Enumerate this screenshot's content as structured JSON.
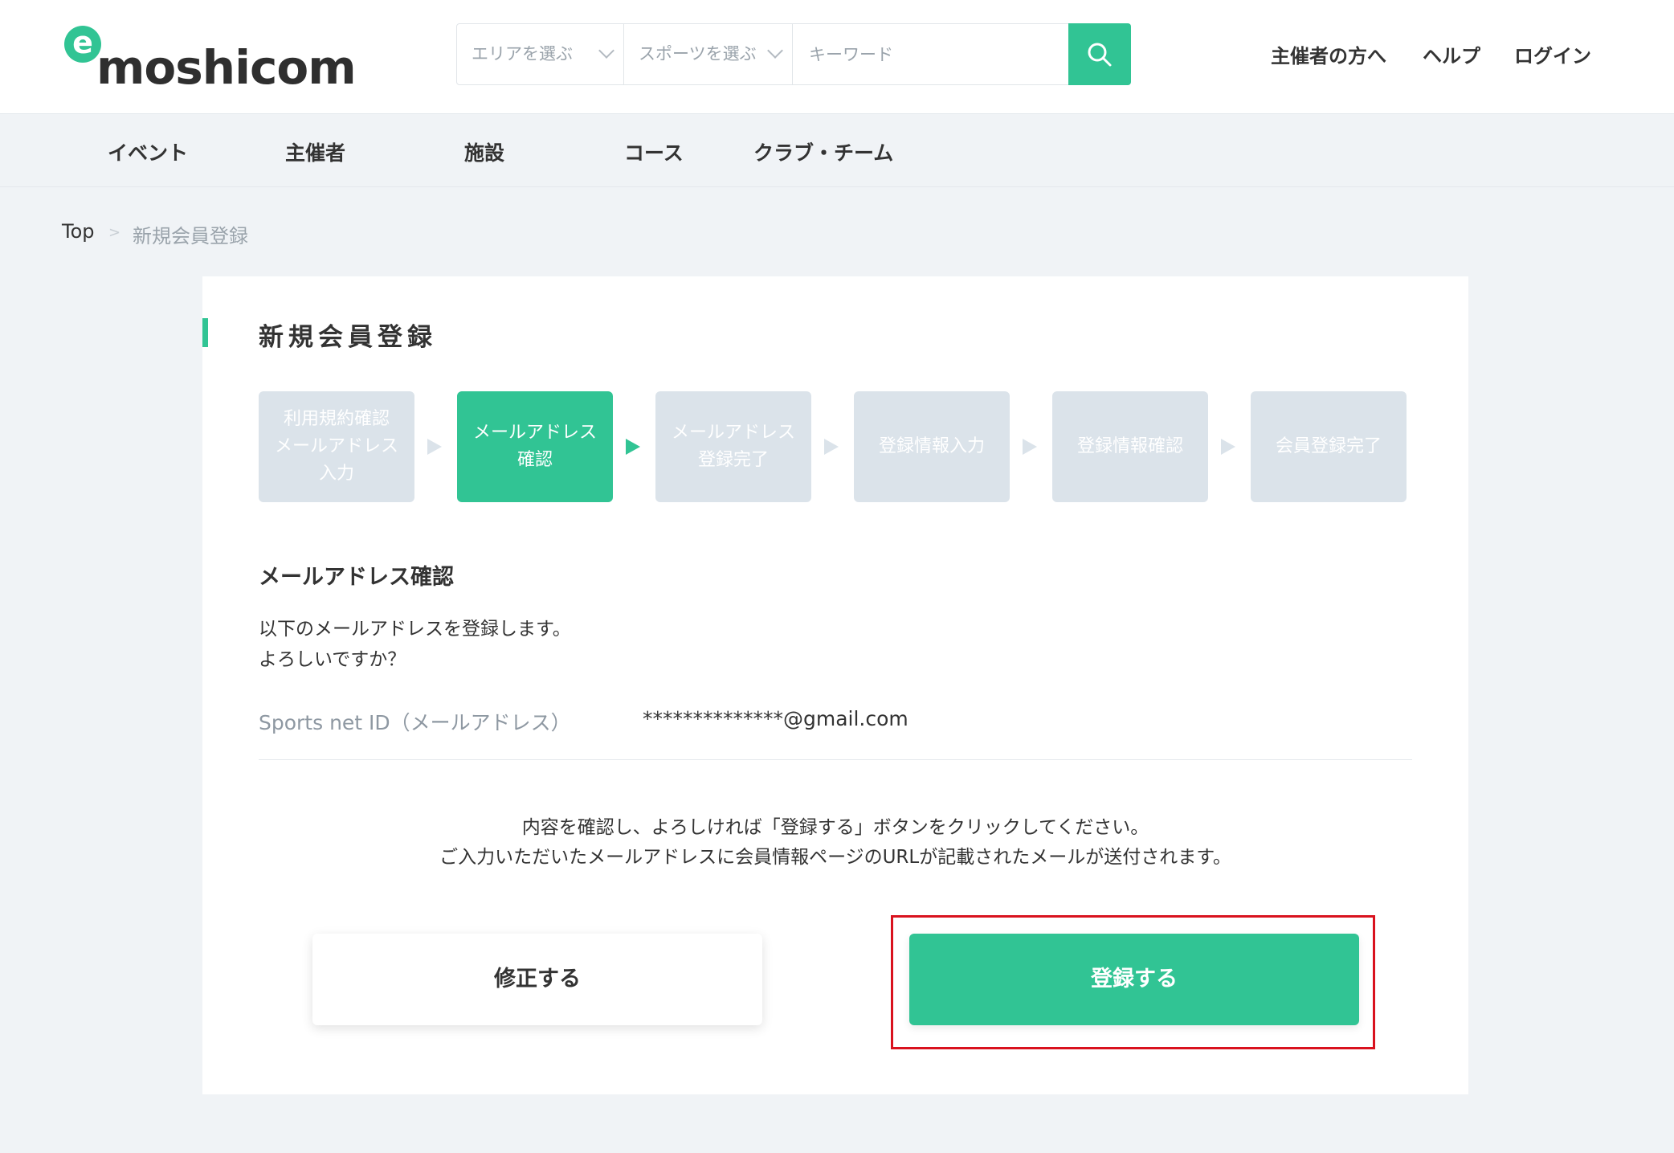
{
  "header": {
    "logo_letter": "e",
    "logo_text": "moshicom",
    "search": {
      "area_label": "エリアを選ぶ",
      "sport_label": "スポーツを選ぶ",
      "keyword_placeholder": "キーワード"
    },
    "nav": [
      "主催者の方へ",
      "ヘルプ",
      "ログイン"
    ]
  },
  "subnav": [
    "イベント",
    "主催者",
    "施設",
    "コース",
    "クラブ・チーム"
  ],
  "breadcrumb": {
    "top": "Top",
    "separator": ">",
    "current": "新規会員登録"
  },
  "page_title": "新規会員登録",
  "steps": [
    {
      "label": "利用規約確認\nメールアドレス\n入力",
      "active": false
    },
    {
      "label": "メールアドレス\n確認",
      "active": true
    },
    {
      "label": "メールアドレス\n登録完了",
      "active": false
    },
    {
      "label": "登録情報入力",
      "active": false
    },
    {
      "label": "登録情報確認",
      "active": false
    },
    {
      "label": "会員登録完了",
      "active": false
    }
  ],
  "section_title": "メールアドレス確認",
  "description": [
    "以下のメールアドレスを登録します。",
    "よろしいですか？"
  ],
  "field": {
    "label": "Sports net ID（メールアドレス）",
    "value": "**************@gmail.com"
  },
  "notice": [
    "内容を確認し、よろしければ「登録する」ボタンをクリックしてください。",
    "ご入力いただいたメールアドレスに会員情報ページのURLが記載されたメールが送付されます。"
  ],
  "buttons": {
    "edit": "修正する",
    "submit": "登録する"
  },
  "colors": {
    "accent": "#31c494",
    "step_inactive": "#dbe3ea",
    "highlight": "#d9121e",
    "background": "#f0f3f6"
  }
}
